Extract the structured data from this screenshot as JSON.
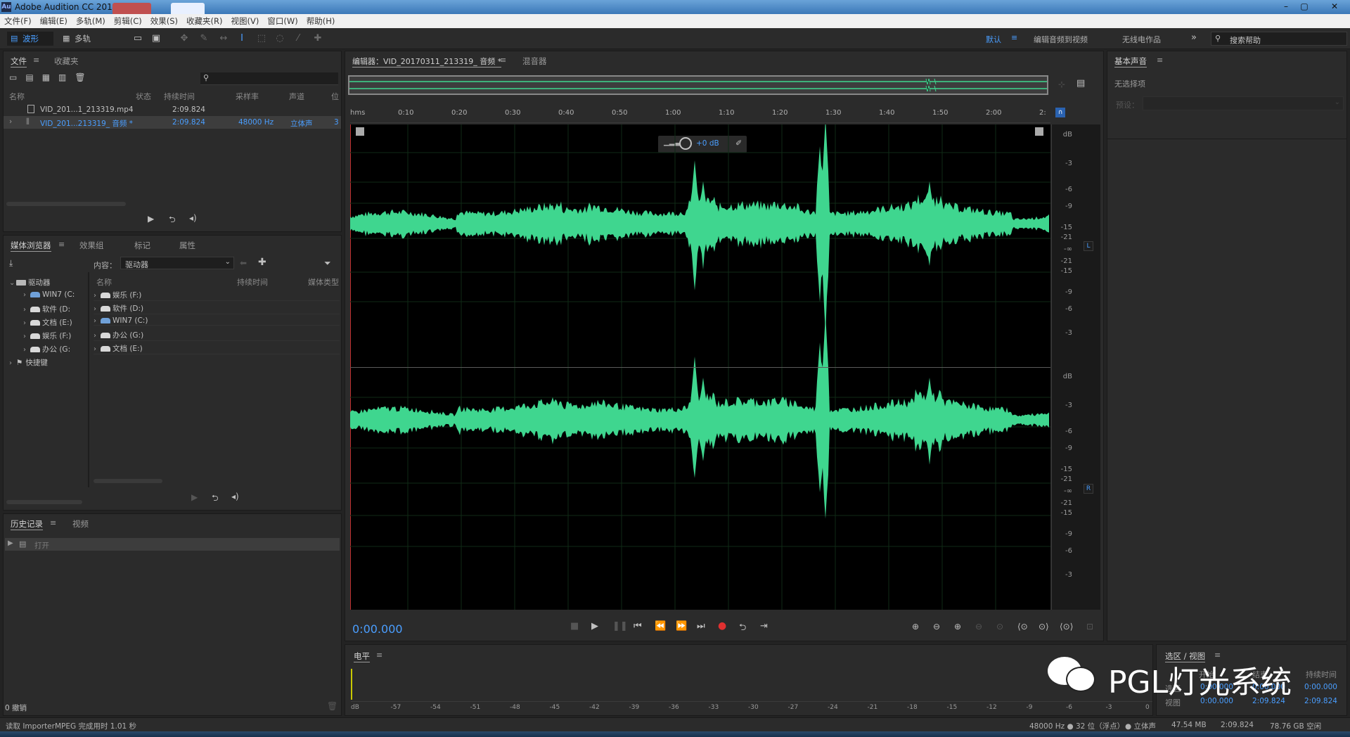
{
  "app": {
    "title": "Adobe Audition CC 2018",
    "logo": "Au",
    "window_controls": [
      "–",
      "▢",
      "✕"
    ]
  },
  "menu": [
    "文件(F)",
    "编辑(E)",
    "多轨(M)",
    "剪辑(C)",
    "效果(S)",
    "收藏夹(R)",
    "视图(V)",
    "窗口(W)",
    "帮助(H)"
  ],
  "toolbar": {
    "waveform_label": "波形",
    "multitrack_label": "多轨",
    "workspace_default": "默认",
    "workspace_edit_video": "编辑音频到视频",
    "workspace_radio": "无线电作品",
    "search_placeholder": "搜索帮助"
  },
  "files_panel": {
    "tabs": [
      "文件",
      "收藏夹"
    ],
    "columns": [
      "名称",
      "状态",
      "持续时间",
      "采样率",
      "声道",
      "位"
    ],
    "rows": [
      {
        "name": "VID_201...1_213319.mp4",
        "status": "",
        "duration": "2:09.824",
        "rate": "",
        "channels": "",
        "bits": ""
      },
      {
        "name": "VID_201...213319_ 音频 *",
        "status": "",
        "duration": "2:09.824",
        "rate": "48000 Hz",
        "channels": "立体声",
        "bits": "3"
      }
    ]
  },
  "media_browser": {
    "tabs": [
      "媒体浏览器",
      "效果组",
      "标记",
      "属性"
    ],
    "content_label": "内容：",
    "content_value": "驱动器",
    "left_tree": [
      {
        "label": "驱动器",
        "icon": "drives-icon"
      },
      {
        "label": "WIN7 (C:",
        "icon": "windows-drive-icon"
      },
      {
        "label": "软件 (D:",
        "icon": "drive-icon"
      },
      {
        "label": "文档 (E:)",
        "icon": "drive-icon"
      },
      {
        "label": "娱乐 (F:)",
        "icon": "drive-icon"
      },
      {
        "label": "办公 (G:",
        "icon": "drive-icon"
      },
      {
        "label": "快捷键",
        "icon": "flag-icon"
      }
    ],
    "columns": [
      "名称",
      "持续时间",
      "媒体类型"
    ],
    "right_list": [
      {
        "label": "娱乐 (F:)",
        "icon": "drive-icon"
      },
      {
        "label": "软件 (D:)",
        "icon": "drive-icon"
      },
      {
        "label": "WIN7 (C:)",
        "icon": "windows-drive-icon"
      },
      {
        "label": "办公 (G:)",
        "icon": "drive-icon"
      },
      {
        "label": "文档 (E:)",
        "icon": "drive-icon"
      }
    ]
  },
  "history": {
    "tabs": [
      "历史记录",
      "视频"
    ],
    "items": [
      "打开"
    ],
    "undo_count": "0 撤销"
  },
  "editor": {
    "tab_label": "编辑器：VID_20170311_213319_ 音频 *",
    "mixer_label": "混音器",
    "hud_gain": "+0 dB",
    "ruler": [
      "hms",
      "0:10",
      "0:20",
      "0:30",
      "0:40",
      "0:50",
      "1:00",
      "1:10",
      "1:20",
      "1:30",
      "1:40",
      "1:50",
      "2:00",
      "2:"
    ],
    "db_scale_top": [
      "dB",
      "-3",
      "-6",
      "-9",
      "-15",
      "-21",
      "-∞",
      "-21",
      "-15",
      "-9",
      "-6",
      "-3"
    ],
    "db_scale_bottom": [
      "dB",
      "-3",
      "-6",
      "-9",
      "-15",
      "-21",
      "-∞",
      "-21",
      "-15",
      "-9",
      "-6",
      "-3"
    ],
    "channel_left": "L",
    "channel_right": "R",
    "time_display": "0:00.000",
    "wave_color": "#3fd68f"
  },
  "essential_sound": {
    "title": "基本声音",
    "no_selection": "无选择项",
    "preset_label": "预设："
  },
  "levels": {
    "title": "电平",
    "scale": [
      "dB",
      "-57",
      "-54",
      "-51",
      "-48",
      "-45",
      "-42",
      "-39",
      "-36",
      "-33",
      "-30",
      "-27",
      "-24",
      "-21",
      "-18",
      "-15",
      "-12",
      "-9",
      "-6",
      "-3",
      "0"
    ]
  },
  "selection_view": {
    "title": "选区 / 视图",
    "col_start": "开始",
    "col_end": "结束",
    "col_duration": "持续时间",
    "row_selection": "选区",
    "row_view": "视图",
    "selection": [
      "0:00.000",
      "0:00.000",
      "0:00.000"
    ],
    "view": [
      "0:00.000",
      "2:09.824",
      "2:09.824"
    ]
  },
  "watermark": "PGL灯光系统",
  "status": {
    "message": "读取 ImporterMPEG 完成用时 1.01 秒",
    "format": "48000 Hz ● 32 位（浮点）",
    "channels": "● 立体声",
    "size": "47.54 MB",
    "duration": "2:09.824",
    "free": "78.76 GB 空闲"
  }
}
